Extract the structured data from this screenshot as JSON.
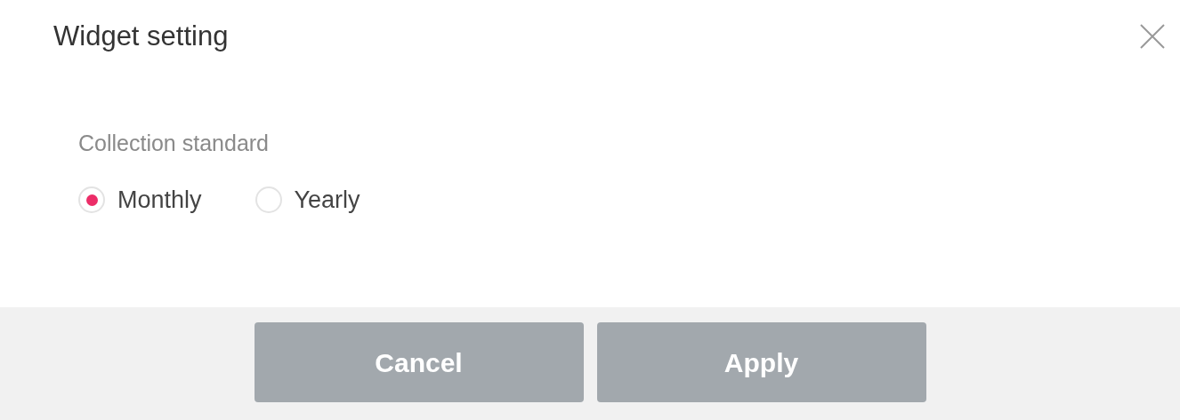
{
  "dialog": {
    "title": "Widget setting"
  },
  "section": {
    "label": "Collection standard",
    "options": [
      {
        "label": "Monthly",
        "selected": true
      },
      {
        "label": "Yearly",
        "selected": false
      }
    ]
  },
  "buttons": [
    {
      "label": "Cancel"
    },
    {
      "label": "Apply"
    }
  ]
}
